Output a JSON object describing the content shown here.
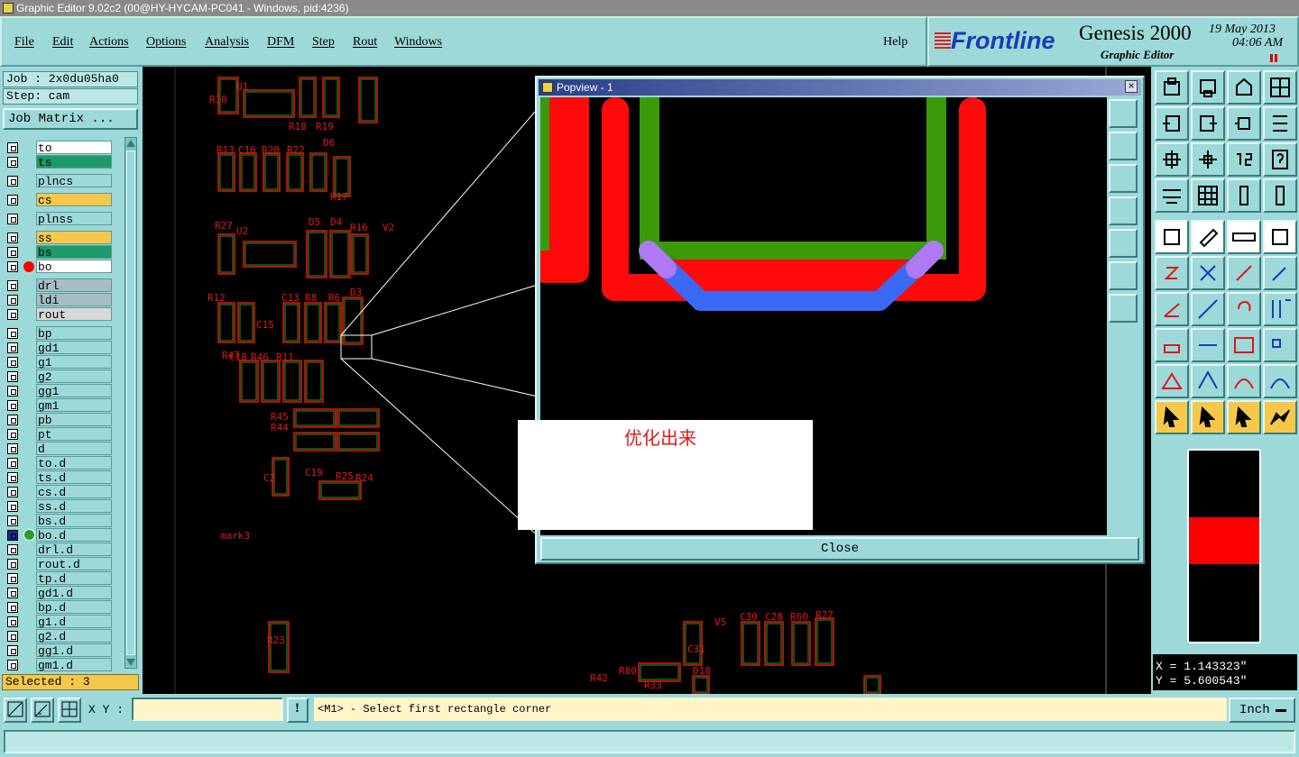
{
  "window": {
    "title": "Graphic Editor 9.02c2 (00@HY-HYCAM-PC041 - Windows, pid:4236)"
  },
  "menu": {
    "items": [
      "File",
      "Edit",
      "Actions",
      "Options",
      "Analysis",
      "DFM",
      "Step",
      "Rout",
      "Windows"
    ],
    "help": "Help"
  },
  "brand": {
    "logo": "Frontline",
    "product": "Genesis 2000",
    "subtitle": "Graphic Editor",
    "date": "19 May 2013",
    "time": "04:06 AM"
  },
  "job": {
    "job": "Job : 2x0du05ha0",
    "step": "Step: cam",
    "matrix_button": "Job Matrix ..."
  },
  "layers": [
    {
      "name": "to",
      "color": "#ffffff",
      "group": 1
    },
    {
      "name": "ts",
      "color": "#1e9a6a",
      "group": 1
    },
    {
      "name": "plncs",
      "color": "#9dd9d9",
      "group": 2
    },
    {
      "name": "cs",
      "color": "#f5c84a",
      "group": 3
    },
    {
      "name": "plnss",
      "color": "#9dd9d9",
      "group": 4
    },
    {
      "name": "ss",
      "color": "#f5c84a",
      "group": 5
    },
    {
      "name": "bs",
      "color": "#1e9a6a",
      "group": 5
    },
    {
      "name": "bo",
      "color": "#ffffff",
      "group": 5
    },
    {
      "name": "drl",
      "color": "#a8bcc4",
      "group": 6
    },
    {
      "name": "ldi",
      "color": "#a8bcc4",
      "group": 6
    },
    {
      "name": "rout",
      "color": "#d8d8d8",
      "group": 6
    },
    {
      "name": "bp",
      "color": "#9dd9d9",
      "group": 7
    },
    {
      "name": "gd1",
      "color": "#9dd9d9",
      "group": 7
    },
    {
      "name": "g1",
      "color": "#9dd9d9",
      "group": 7
    },
    {
      "name": "g2",
      "color": "#9dd9d9",
      "group": 7
    },
    {
      "name": "gg1",
      "color": "#9dd9d9",
      "group": 7
    },
    {
      "name": "gm1",
      "color": "#9dd9d9",
      "group": 7
    },
    {
      "name": "pb",
      "color": "#9dd9d9",
      "group": 7
    },
    {
      "name": "pt",
      "color": "#9dd9d9",
      "group": 7
    },
    {
      "name": "d",
      "color": "#9dd9d9",
      "group": 7
    },
    {
      "name": "to.d",
      "color": "#9dd9d9",
      "group": 7
    },
    {
      "name": "ts.d",
      "color": "#9dd9d9",
      "group": 7
    },
    {
      "name": "cs.d",
      "color": "#9dd9d9",
      "group": 7
    },
    {
      "name": "ss.d",
      "color": "#9dd9d9",
      "group": 7
    },
    {
      "name": "bs.d",
      "color": "#9dd9d9",
      "group": 7
    },
    {
      "name": "bo.d",
      "color": "#9dd9d9",
      "group": 7
    },
    {
      "name": "drl.d",
      "color": "#9dd9d9",
      "group": 7
    },
    {
      "name": "rout.d",
      "color": "#9dd9d9",
      "group": 7
    },
    {
      "name": "tp.d",
      "color": "#9dd9d9",
      "group": 7
    },
    {
      "name": "gd1.d",
      "color": "#9dd9d9",
      "group": 7
    },
    {
      "name": "bp.d",
      "color": "#9dd9d9",
      "group": 7
    },
    {
      "name": "g1.d",
      "color": "#9dd9d9",
      "group": 7
    },
    {
      "name": "g2.d",
      "color": "#9dd9d9",
      "group": 7
    },
    {
      "name": "gg1.d",
      "color": "#9dd9d9",
      "group": 7
    },
    {
      "name": "gm1.d",
      "color": "#9dd9d9",
      "group": 7
    }
  ],
  "selected": "Selected : 3",
  "popview": {
    "title": "Popview - 1",
    "close_button": "Close"
  },
  "annotation": "优化出来",
  "coords": {
    "x": "X = 1.143323\"",
    "y": "Y = 5.600543\""
  },
  "bottom": {
    "xy_label": "X Y :",
    "xy_value": "",
    "prompt": "<M1> - Select first rectangle corner",
    "units": "Inch"
  },
  "pcb_labels": [
    "R10",
    "U1",
    "R18",
    "R19",
    "D6",
    "R13",
    "C16",
    "R20",
    "R22",
    "R17",
    "R27",
    "U2",
    "D5",
    "D4",
    "R16",
    "V2",
    "R12",
    "C15",
    "C13",
    "R8",
    "R6",
    "D3",
    "R11",
    "R46",
    "C18",
    "R47",
    "R45",
    "R44",
    "C19",
    "C2",
    "R25",
    "R24",
    "mark3",
    "R23",
    "V5",
    "C30",
    "C28",
    "R60",
    "R27",
    "C31",
    "R80",
    "D18",
    "R42",
    "R33"
  ],
  "colors": {
    "panel": "#9dd9d9",
    "accent": "#f5c84a",
    "trace_red": "#ff0a0a",
    "trace_green": "#3a9a0a",
    "trace_blue": "#3a6af5",
    "trace_violet": "#b07af5"
  }
}
